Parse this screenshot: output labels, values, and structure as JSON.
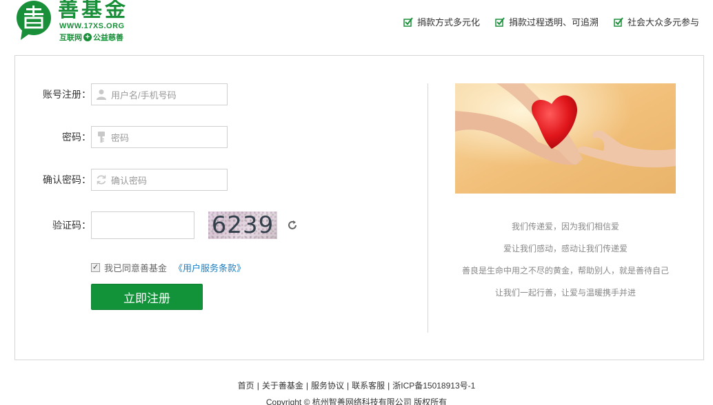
{
  "header": {
    "logo_title": "善基金",
    "logo_url": "WWW.17XS.ORG",
    "logo_slogan_left": "互联网",
    "logo_slogan_right": "公益慈善",
    "features": [
      "捐款方式多元化",
      "捐款过程透明、可追溯",
      "社会大众多元参与"
    ]
  },
  "form": {
    "account_label": "账号注册：",
    "account_placeholder": "用户名/手机号码",
    "password_label": "密码：",
    "password_placeholder": "密码",
    "confirm_label": "确认密码：",
    "confirm_placeholder": "确认密码",
    "captcha_label": "验证码：",
    "captcha_value": "6239",
    "agree_text": "我已同意善基金",
    "terms_link": "《用户服务条款》",
    "submit_label": "立即注册"
  },
  "slogans": [
    "我们传递爱，因为我们相信爱",
    "爱让我们感动，感动让我们传递爱",
    "善良是生命中用之不尽的黄金，帮助别人，就是善待自己",
    "让我们一起行善，让爱与温暖携手并进"
  ],
  "footer": {
    "links": [
      "首页",
      "关于善基金",
      "服务协议",
      "联系客服",
      "浙ICP备15018913号-1"
    ],
    "separator": "|",
    "copyright": "Copyright ©   杭州智善网络科技有限公司  版权所有"
  },
  "colors": {
    "brand_green": "#1a8f3a",
    "button_green": "#12933a",
    "link_blue": "#1a7fc1"
  }
}
